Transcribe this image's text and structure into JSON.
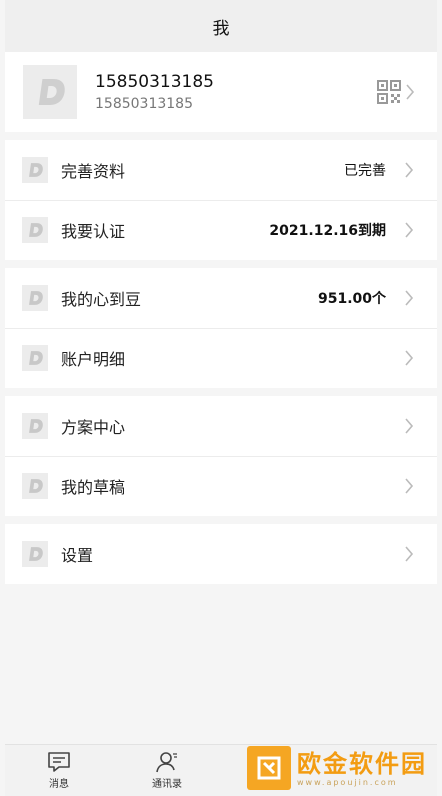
{
  "header": {
    "title": "我"
  },
  "profile": {
    "name": "15850313185",
    "subtitle": "15850313185",
    "avatar_icon": "logo-d-icon",
    "qr_icon": "qr-code-icon"
  },
  "menu": {
    "complete_profile": {
      "label": "完善资料",
      "value": "已完善"
    },
    "certification": {
      "label": "我要认证",
      "value": "2021.12.16到期"
    },
    "beans": {
      "label": "我的心到豆",
      "value": "951.00个"
    },
    "account_detail": {
      "label": "账户明细"
    },
    "plan_center": {
      "label": "方案中心"
    },
    "drafts": {
      "label": "我的草稿"
    },
    "settings": {
      "label": "设置"
    }
  },
  "tabbar": {
    "messages": {
      "label": "消息",
      "icon": "message-icon"
    },
    "contacts": {
      "label": "通讯录",
      "icon": "contacts-icon"
    }
  },
  "watermark": {
    "title": "欧金软件园",
    "url": "www.apoujin.com"
  },
  "colors": {
    "background": "#f5f5f5",
    "header": "#efefef",
    "accent": "#f39c12"
  }
}
